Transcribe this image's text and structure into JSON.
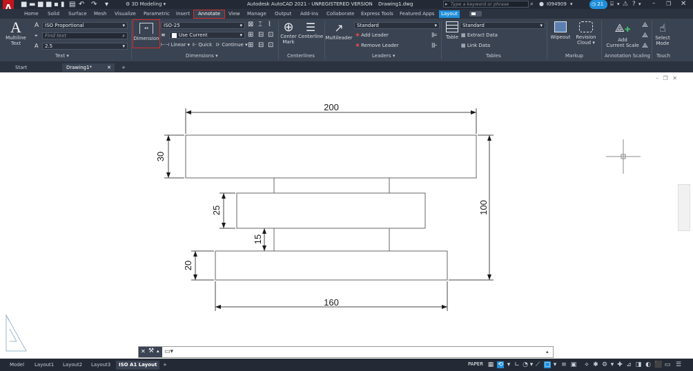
{
  "titlebar": {
    "workspace": "3D Modeling",
    "title": "Autodesk AutoCAD 2021 - UNREGISTERED VERSION",
    "filename": "Drawing1.dwg",
    "search_placeholder": "Type a keyword or phrase",
    "user": "I094909",
    "notify_count": "21"
  },
  "ribbon_tabs": [
    "Home",
    "Solid",
    "Surface",
    "Mesh",
    "Visualize",
    "Parametric",
    "Insert",
    "Annotate",
    "View",
    "Manage",
    "Output",
    "Add-ins",
    "Collaborate",
    "Express Tools",
    "Featured Apps",
    "Layout"
  ],
  "ribbon": {
    "text_panel": {
      "multiline_text": "Multiline",
      "multiline_text2": "Text",
      "style": "ISO Proportional",
      "find_placeholder": "Find text",
      "height": "2.5",
      "label": "Text"
    },
    "dimensions_panel": {
      "dimension": "Dimension",
      "dimstyle": "ISO-25",
      "use_current": "Use Current",
      "linear": "Linear",
      "quick": "Quick",
      "continue": "Continue",
      "label": "Dimensions"
    },
    "centerlines_panel": {
      "center_mark": "Center",
      "center_mark2": "Mark",
      "centerline": "Centerline",
      "label": "Centerlines"
    },
    "leaders_panel": {
      "multileader": "Multileader",
      "style": "Standard",
      "add_leader": "Add Leader",
      "remove_leader": "Remove Leader",
      "label": "Leaders"
    },
    "tables_panel": {
      "table": "Table",
      "style": "Standard",
      "extract_data": "Extract Data",
      "link_data": "Link Data",
      "label": "Tables"
    },
    "markup_panel": {
      "wipeout": "Wipeout",
      "revision_cloud": "Revision",
      "revision_cloud2": "Cloud",
      "label": "Markup"
    },
    "annotation_scaling_panel": {
      "add_current_scale": "Add",
      "add_current_scale2": "Current Scale",
      "label": "Annotation Scaling"
    },
    "touch_panel": {
      "select_mode": "Select",
      "select_mode2": "Mode",
      "label": "Touch"
    }
  },
  "file_tabs": [
    "Start",
    "Drawing1*"
  ],
  "drawing": {
    "dim_top": "200",
    "dim_left_top": "30",
    "dim_left_mid": "25",
    "dim_gap": "15",
    "dim_left_bottom": "20",
    "dim_right": "100",
    "dim_bottom": "160"
  },
  "layout_tabs": [
    "Model",
    "Layout1",
    "Layout2",
    "Layout3",
    "ISO A1 Layout"
  ],
  "status": {
    "paper": "PAPER"
  },
  "colors": {
    "accent": "#1f8fd9",
    "highlight": "#d62b2b",
    "ribbon_bg": "#3a4352"
  }
}
